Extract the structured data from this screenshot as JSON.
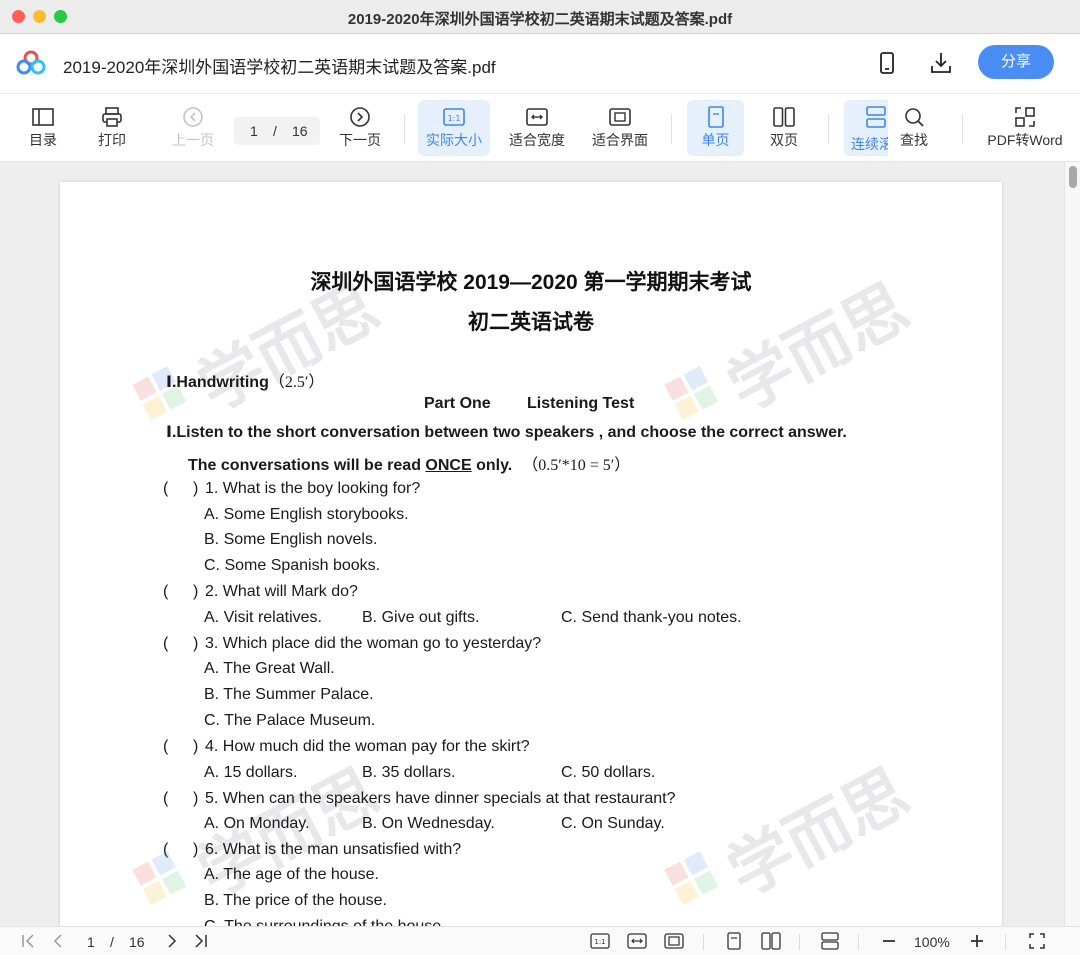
{
  "window": {
    "title": "2019-2020年深圳外国语学校初二英语期末试题及答案.pdf"
  },
  "header": {
    "file_name": "2019-2020年深圳外国语学校初二英语期末试题及答案.pdf",
    "share_label": "分享",
    "icons": [
      "mobile-icon",
      "download-icon"
    ]
  },
  "toolbar": {
    "toc": "目录",
    "print": "打印",
    "prev": "上一页",
    "page_current": "1",
    "page_sep": "/",
    "page_total": "16",
    "next": "下一页",
    "actual_size": "实际大小",
    "fit_width": "适合宽度",
    "fit_page": "适合界面",
    "single": "单页",
    "double": "双页",
    "continuous": "连续滚",
    "find": "查找",
    "pdf2word": "PDF转Word",
    "active_color": "#3f86ea"
  },
  "document": {
    "watermark": "学而思",
    "title1": "深圳外国语学校 2019—2020 第一学期期末考试",
    "title2": "初二英语试卷",
    "section1_label": "Ⅰ.Handwriting",
    "section1_score": "（2.5′）",
    "part_one": "Part One",
    "listening_test": "Listening Test",
    "instruction1": "Ⅰ.Listen to the short conversation between two speakers , and choose the correct answer.",
    "instruction2_a": "The conversations will be read ",
    "instruction2_once": "ONCE",
    "instruction2_b": " only.",
    "instruction2_score": "（0.5′*10 = 5′）",
    "paren_open": "(",
    "paren_close": ")",
    "q1": "1. What is the boy looking for?",
    "q1a": "A. Some English storybooks.",
    "q1b": "B. Some English novels.",
    "q1c": "C. Some Spanish books.",
    "q2": "2. What will Mark do?",
    "q2a": "A. Visit relatives.",
    "q2b": "B. Give out gifts.",
    "q2c": "C. Send thank-you notes.",
    "q3": "3. Which place did the woman go to yesterday?",
    "q3a": "A. The Great Wall.",
    "q3b": "B. The Summer Palace.",
    "q3c": "C. The Palace Museum.",
    "q4": "4. How much did the woman pay for the skirt?",
    "q4a": "A. 15 dollars.",
    "q4b": "B. 35 dollars.",
    "q4c": "C. 50 dollars.",
    "q5": "5. When can the speakers have dinner specials at that restaurant?",
    "q5a": "A. On Monday.",
    "q5b": "B. On Wednesday.",
    "q5c": "C. On Sunday.",
    "q6": "6. What is the man unsatisfied with?",
    "q6a": "A. The age of the house.",
    "q6b": "B. The price of the house.",
    "q6c": "C. The surroundings of the house."
  },
  "bottombar": {
    "page_current": "1",
    "page_sep": "/",
    "page_total": "16",
    "zoom": "100%"
  }
}
